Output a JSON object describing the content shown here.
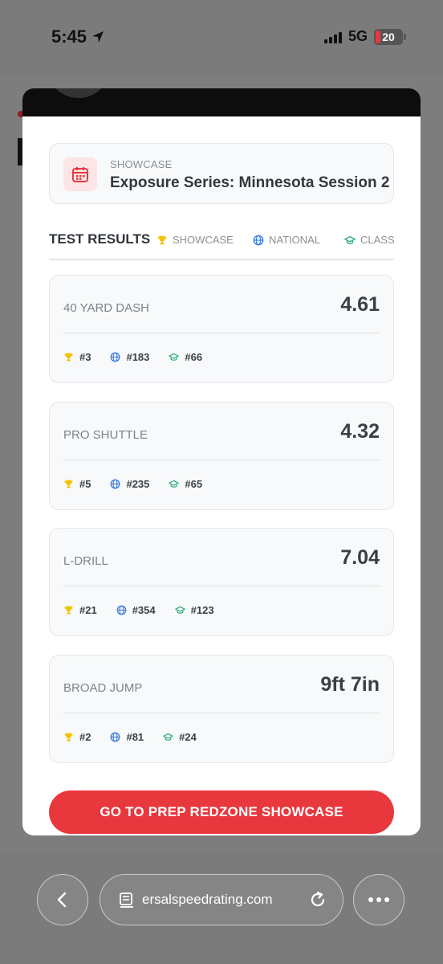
{
  "status_bar": {
    "time": "5:45",
    "network": "5G",
    "battery": "20"
  },
  "modal": {
    "event": {
      "kicker": "SHOWCASE",
      "title": "Exposure Series: Minnesota Session 2"
    },
    "results_header": {
      "title": "TEST RESULTS",
      "legend": [
        {
          "label": "SHOWCASE",
          "icon": "trophy-icon",
          "color": "#f2c200"
        },
        {
          "label": "NATIONAL",
          "icon": "globe-icon",
          "color": "#3b7ddd"
        },
        {
          "label": "CLASS",
          "icon": "graduation-cap-icon",
          "color": "#2fae7a"
        }
      ]
    },
    "tests": [
      {
        "name": "40 YARD DASH",
        "value": "4.61",
        "showcase_rank": "#3",
        "national_rank": "#183",
        "class_rank": "#66"
      },
      {
        "name": "PRO SHUTTLE",
        "value": "4.32",
        "showcase_rank": "#5",
        "national_rank": "#235",
        "class_rank": "#65"
      },
      {
        "name": "L-DRILL",
        "value": "7.04",
        "showcase_rank": "#21",
        "national_rank": "#354",
        "class_rank": "#123"
      },
      {
        "name": "BROAD JUMP",
        "value": "9ft 7in",
        "showcase_rank": "#2",
        "national_rank": "#81",
        "class_rank": "#24"
      }
    ],
    "cta_label": "GO TO PREP REDZONE SHOWCASE"
  },
  "browser": {
    "url": "ersalspeedrating.com"
  }
}
